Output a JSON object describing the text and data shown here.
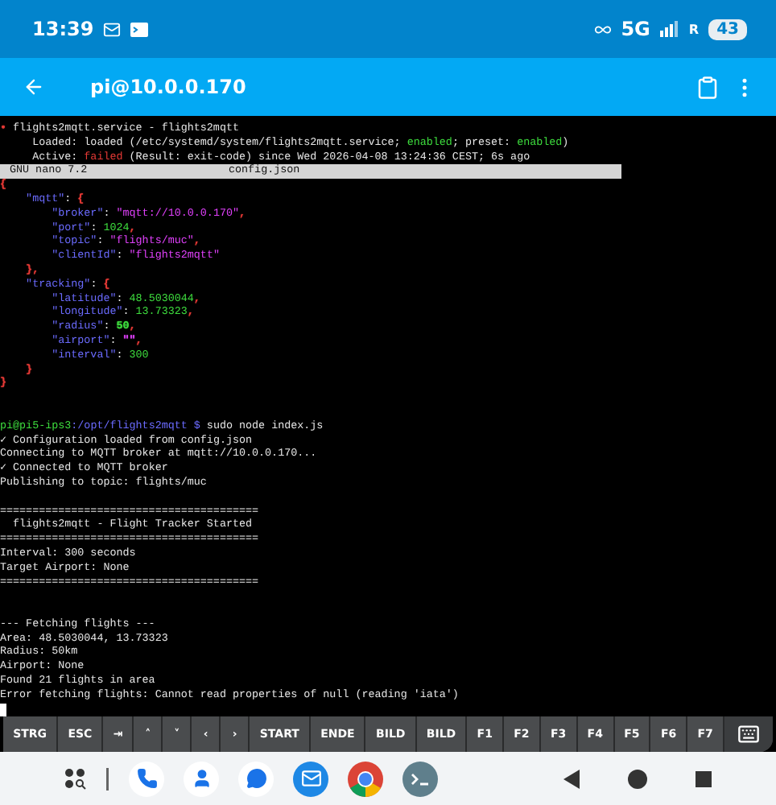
{
  "status_bar": {
    "time": "13:39",
    "network": "5G",
    "roaming": "R",
    "battery": "43"
  },
  "app_bar": {
    "title": "pi@10.0.0.170"
  },
  "terminal": {
    "lines": [
      {
        "kind": "text",
        "segments": [
          {
            "text": "•",
            "color": "#e53935"
          },
          {
            "text": " flights2mqtt.service - flights2mqtt"
          }
        ]
      },
      {
        "kind": "text",
        "segments": [
          {
            "text": "     Loaded: loaded (/etc/systemd/system/flights2mqtt.service; "
          },
          {
            "text": "enabled",
            "color": "#3ddc3d"
          },
          {
            "text": "; preset: "
          },
          {
            "text": "enabled",
            "color": "#3ddc3d"
          },
          {
            "text": ")"
          }
        ]
      },
      {
        "kind": "text",
        "segments": [
          {
            "text": "     Active: "
          },
          {
            "text": "failed",
            "color": "#e53935"
          },
          {
            "text": " (Result: exit-code) since Wed 2026-04-08 13:24:36 CEST; 6s ago"
          }
        ]
      },
      {
        "kind": "nano_bar",
        "left": "GNU nano 7.2",
        "center": "config.json"
      },
      {
        "kind": "text",
        "segments": [
          {
            "text": "{",
            "color": "#e53935"
          }
        ]
      },
      {
        "kind": "text",
        "segments": [
          {
            "text": "    \"mqtt\"",
            "color": "#6b6bff"
          },
          {
            "text": ": "
          },
          {
            "text": "{",
            "color": "#e53935"
          }
        ]
      },
      {
        "kind": "text",
        "segments": [
          {
            "text": "        \"broker\"",
            "color": "#6b6bff"
          },
          {
            "text": ": "
          },
          {
            "text": "\"mqtt://10.0.0.170\"",
            "color": "#e040fb"
          },
          {
            "text": ",",
            "color": "#e53935"
          }
        ]
      },
      {
        "kind": "text",
        "segments": [
          {
            "text": "        \"port\"",
            "color": "#6b6bff"
          },
          {
            "text": ": "
          },
          {
            "text": "1024",
            "color": "#3ddc3d"
          },
          {
            "text": ",",
            "color": "#e53935"
          }
        ]
      },
      {
        "kind": "text",
        "segments": [
          {
            "text": "        \"topic\"",
            "color": "#6b6bff"
          },
          {
            "text": ": "
          },
          {
            "text": "\"flights/muc\"",
            "color": "#e040fb"
          },
          {
            "text": ",",
            "color": "#e53935"
          }
        ]
      },
      {
        "kind": "text",
        "segments": [
          {
            "text": "        \"clientId\"",
            "color": "#6b6bff"
          },
          {
            "text": ": "
          },
          {
            "text": "\"flights2mqtt\"",
            "color": "#e040fb"
          }
        ]
      },
      {
        "kind": "text",
        "segments": [
          {
            "text": "    },",
            "color": "#e53935"
          }
        ]
      },
      {
        "kind": "text",
        "segments": [
          {
            "text": "    \"tracking\"",
            "color": "#6b6bff"
          },
          {
            "text": ": "
          },
          {
            "text": "{",
            "color": "#e53935"
          }
        ]
      },
      {
        "kind": "text",
        "segments": [
          {
            "text": "        \"latitude\"",
            "color": "#6b6bff"
          },
          {
            "text": ": "
          },
          {
            "text": "48.5030044",
            "color": "#3ddc3d"
          },
          {
            "text": ",",
            "color": "#e53935"
          }
        ]
      },
      {
        "kind": "text",
        "segments": [
          {
            "text": "        \"longitude\"",
            "color": "#6b6bff"
          },
          {
            "text": ": "
          },
          {
            "text": "13.73323",
            "color": "#3ddc3d"
          },
          {
            "text": ",",
            "color": "#e53935"
          }
        ]
      },
      {
        "kind": "text",
        "segments": [
          {
            "text": "        \"radius\"",
            "color": "#6b6bff"
          },
          {
            "text": ": "
          },
          {
            "text": "50",
            "color": "#3ddc3d"
          },
          {
            "text": ",",
            "color": "#e53935"
          }
        ]
      },
      {
        "kind": "text",
        "segments": [
          {
            "text": "        \"airport\"",
            "color": "#6b6bff"
          },
          {
            "text": ": "
          },
          {
            "text": "\"\"",
            "color": "#e040fb"
          },
          {
            "text": ",",
            "color": "#e53935"
          }
        ]
      },
      {
        "kind": "text",
        "segments": [
          {
            "text": "        \"interval\"",
            "color": "#6b6bff"
          },
          {
            "text": ": "
          },
          {
            "text": "300",
            "color": "#3ddc3d"
          }
        ]
      },
      {
        "kind": "text",
        "segments": [
          {
            "text": "    }",
            "color": "#e53935"
          }
        ]
      },
      {
        "kind": "text",
        "segments": [
          {
            "text": "}",
            "color": "#e53935"
          }
        ]
      },
      {
        "kind": "blank"
      },
      {
        "kind": "blank"
      },
      {
        "kind": "text",
        "segments": [
          {
            "text": "pi@pi5-ips3",
            "color": "#3ddc3d"
          },
          {
            "text": ":/opt/flights2mqtt $",
            "color": "#6b6bff"
          },
          {
            "text": " sudo node index.js"
          }
        ]
      },
      {
        "kind": "text",
        "segments": [
          {
            "text": "✓ Configuration loaded from config.json"
          }
        ]
      },
      {
        "kind": "text",
        "segments": [
          {
            "text": "Connecting to MQTT broker at mqtt://10.0.0.170..."
          }
        ]
      },
      {
        "kind": "text",
        "segments": [
          {
            "text": "✓ Connected to MQTT broker"
          }
        ]
      },
      {
        "kind": "text",
        "segments": [
          {
            "text": "Publishing to topic: flights/muc"
          }
        ]
      },
      {
        "kind": "blank"
      },
      {
        "kind": "text",
        "segments": [
          {
            "text": "========================================"
          }
        ]
      },
      {
        "kind": "text",
        "segments": [
          {
            "text": "  flights2mqtt - Flight Tracker Started"
          }
        ]
      },
      {
        "kind": "text",
        "segments": [
          {
            "text": "========================================"
          }
        ]
      },
      {
        "kind": "text",
        "segments": [
          {
            "text": "Interval: 300 seconds"
          }
        ]
      },
      {
        "kind": "text",
        "segments": [
          {
            "text": "Target Airport: None"
          }
        ]
      },
      {
        "kind": "text",
        "segments": [
          {
            "text": "========================================"
          }
        ]
      },
      {
        "kind": "blank"
      },
      {
        "kind": "blank"
      },
      {
        "kind": "text",
        "segments": [
          {
            "text": "--- Fetching flights ---"
          }
        ]
      },
      {
        "kind": "text",
        "segments": [
          {
            "text": "Area: 48.5030044, 13.73323"
          }
        ]
      },
      {
        "kind": "text",
        "segments": [
          {
            "text": "Radius: 50km"
          }
        ]
      },
      {
        "kind": "text",
        "segments": [
          {
            "text": "Airport: None"
          }
        ]
      },
      {
        "kind": "text",
        "segments": [
          {
            "text": "Found 21 flights in area"
          }
        ]
      },
      {
        "kind": "text",
        "segments": [
          {
            "text": "Error fetching flights: Cannot read properties of null (reading 'iata')"
          }
        ]
      },
      {
        "kind": "cursor"
      }
    ]
  },
  "extra_keys": [
    {
      "label": "STRG"
    },
    {
      "label": "ESC"
    },
    {
      "label": "⇥"
    },
    {
      "label": "˄"
    },
    {
      "label": "˅"
    },
    {
      "label": "‹"
    },
    {
      "label": "›"
    },
    {
      "label": "START"
    },
    {
      "label": "ENDE"
    },
    {
      "label": "BILD"
    },
    {
      "label": "BILD"
    },
    {
      "label": "F1"
    },
    {
      "label": "F2"
    },
    {
      "label": "F3"
    },
    {
      "label": "F4"
    },
    {
      "label": "F5"
    },
    {
      "label": "F6"
    },
    {
      "label": "F7"
    }
  ]
}
